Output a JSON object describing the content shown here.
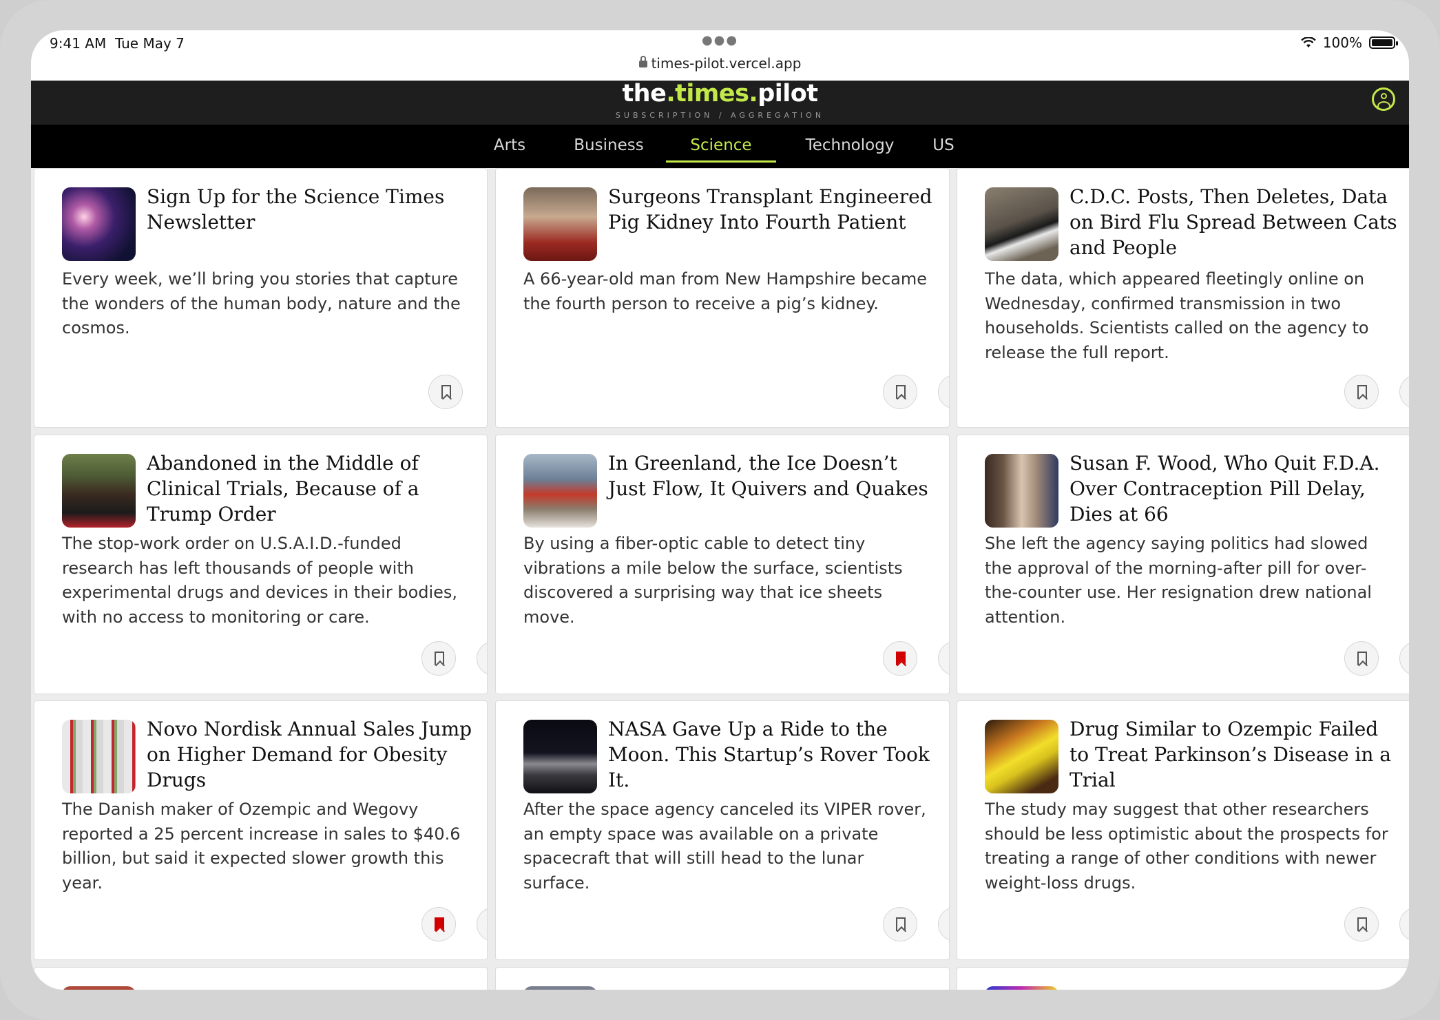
{
  "status_bar": {
    "time": "9:41 AM",
    "date": "Tue May 7",
    "battery": "100%",
    "url": "times-pilot.vercel.app"
  },
  "masthead": {
    "logo_the": "the",
    "logo_times": ".times.",
    "logo_pilot": "pilot",
    "tagline": "SUBSCRIPTION / AGGREGATION"
  },
  "nav": {
    "tabs": [
      "Arts",
      "Business",
      "Science",
      "Technology",
      "US"
    ],
    "active": "Science"
  },
  "colors": {
    "accent": "#c3e84a",
    "bookmarked": "#d10000",
    "masthead_bg": "#1e1e1e",
    "nav_bg": "#000000"
  },
  "articles": [
    {
      "title": "Sign Up for the Science Times Newsletter",
      "dek": "Every week, we’ll bring you stories that capture the wonders of the human body, nature and the cosmos.",
      "bookmarked": false
    },
    {
      "title": "Surgeons Transplant Engineered Pig Kidney Into Fourth Patient",
      "dek": "A 66-year-old man from New Hampshire became the fourth person to receive a pig’s kidney.",
      "bookmarked": false
    },
    {
      "title": "C.D.C. Posts, Then Deletes, Data on Bird Flu Spread Between Cats and People",
      "dek": "The data, which appeared fleetingly online on Wednesday, confirmed transmission in two households. Scientists called on the agency to release the full report.",
      "bookmarked": false
    },
    {
      "title": "Abandoned in the Middle of Clinical Trials, Because of a Trump Order",
      "dek": "The stop-work order on U.S.A.I.D.-funded research has left thousands of people with experimental drugs and devices in their bodies, with no access to monitoring or care.",
      "bookmarked": false
    },
    {
      "title": "In Greenland, the Ice Doesn’t Just Flow, It Quivers and Quakes",
      "dek": "By using a fiber-optic cable to detect tiny vibrations a mile below the surface, scientists discovered a surprising way that ice sheets move.",
      "bookmarked": true
    },
    {
      "title": "Susan F. Wood, Who Quit F.D.A. Over Contraception Pill Delay, Dies at 66",
      "dek": "She left the agency saying politics had slowed the approval of the morning-after pill for over-the-counter use. Her resignation drew national attention.",
      "bookmarked": false
    },
    {
      "title": "Novo Nordisk Annual Sales Jump on Higher Demand for Obesity Drugs",
      "dek": "The Danish maker of Ozempic and Wegovy reported a 25 percent increase in sales to $40.6 billion, but said it expected slower growth this year.",
      "bookmarked": true
    },
    {
      "title": "NASA Gave Up a Ride to the Moon. This Startup’s Rover Took It.",
      "dek": "After the space agency canceled its VIPER rover, an empty space was available on a private spacecraft that will still head to the lunar surface.",
      "bookmarked": false
    },
    {
      "title": "Drug Similar to Ozempic Failed to Treat Parkinson’s Disease in a Trial",
      "dek": "The study may suggest that other researchers should be less optimistic about the prospects for treating a range of other conditions with newer weight-loss drugs.",
      "bookmarked": false
    }
  ]
}
